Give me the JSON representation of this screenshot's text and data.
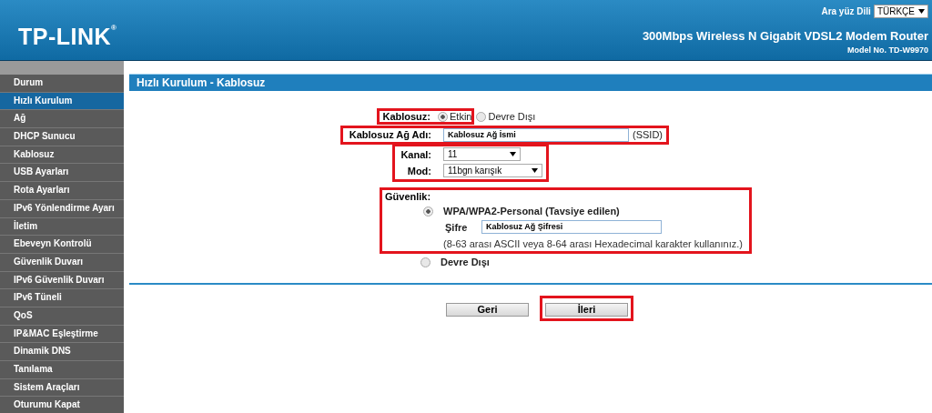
{
  "header": {
    "language_label": "Ara yüz Dili",
    "language_value": "TÜRKÇE",
    "logo": "TP-LINK$^{®}$",
    "product": "300Mbps Wireless N Gigabit VDSL2 Modem Router",
    "model": "Model No. TD-W9970"
  },
  "sidebar": {
    "items": [
      {
        "label": "Durum",
        "selected": false
      },
      {
        "label": "Hızlı Kurulum",
        "selected": true
      },
      {
        "label": "Ağ",
        "selected": false
      },
      {
        "label": "DHCP Sunucu",
        "selected": false
      },
      {
        "label": "Kablosuz",
        "selected": false
      },
      {
        "label": "USB Ayarları",
        "selected": false
      },
      {
        "label": "Rota Ayarları",
        "selected": false
      },
      {
        "label": "IPv6 Yönlendirme Ayarı",
        "selected": false
      },
      {
        "label": "İletim",
        "selected": false
      },
      {
        "label": "Ebeveyn Kontrolü",
        "selected": false
      },
      {
        "label": "Güvenlik Duvarı",
        "selected": false
      },
      {
        "label": "IPv6 Güvenlik Duvarı",
        "selected": false
      },
      {
        "label": "IPv6 Tüneli",
        "selected": false
      },
      {
        "label": "QoS",
        "selected": false
      },
      {
        "label": "IP&MAC Eşleştirme",
        "selected": false
      },
      {
        "label": "Dinamik DNS",
        "selected": false
      },
      {
        "label": "Tanılama",
        "selected": false
      },
      {
        "label": "Sistem Araçları",
        "selected": false
      },
      {
        "label": "Oturumu Kapat",
        "selected": false
      }
    ]
  },
  "page_title": "Hızlı Kurulum - Kablosuz",
  "form": {
    "wireless": {
      "label": "Kablosuz:",
      "highlighted": true,
      "options": [
        {
          "label": "Etkin",
          "selected": true
        },
        {
          "label": "Devre Dışı",
          "selected": false
        }
      ]
    },
    "ssid": {
      "label": "Kablosuz Ağ Adı:",
      "value": "Kablosuz Ağ İsmi",
      "suffix": "(SSID)",
      "highlighted": true
    },
    "radio_settings": {
      "highlighted": true,
      "channel": {
        "label": "Kanal:",
        "value": "11"
      },
      "mode": {
        "label": "Mod:",
        "value": "11bgn karışık"
      }
    },
    "security": {
      "label": "Güvenlik:",
      "highlighted": true,
      "options": [
        {
          "label": "WPA/WPA2-Personal (Tavsiye edilen)",
          "selected": true,
          "password_label": "Şifre",
          "password_value": "Kablosuz Ağ Şifresi",
          "hint": "(8-63 arası ASCII veya 8-64 arası Hexadecimal karakter kullanınız.)"
        },
        {
          "label": "Devre Dışı",
          "selected": false
        }
      ]
    }
  },
  "buttons": [
    {
      "label": "Geri",
      "highlighted": false
    },
    {
      "label": "İleri",
      "highlighted": true
    }
  ]
}
